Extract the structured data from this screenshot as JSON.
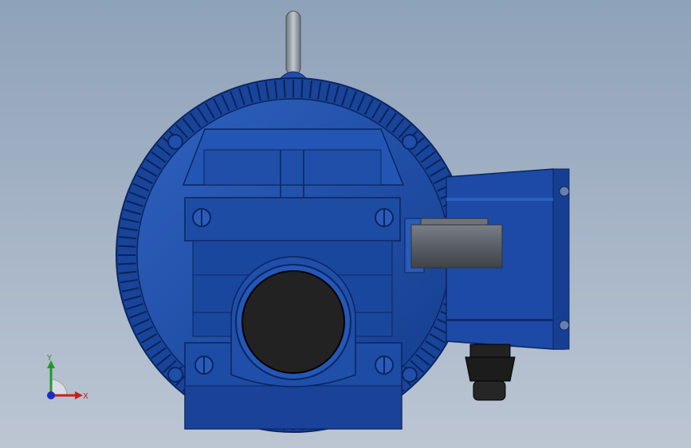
{
  "viewport": {
    "background_top": "#8ea2b9",
    "background_bottom": "#bcc6d3"
  },
  "model": {
    "body_color": "#1f4fa8",
    "body_dark": "#0f2c6e",
    "body_light": "#3a6cc8",
    "shaft_color": "#5a5f66",
    "bore_color": "#222222",
    "gland_color": "#1c1c1c",
    "lifting_eye_color": "#9aa0a8"
  },
  "triad": {
    "x_label": "X",
    "y_label": "Y",
    "x_color": "#c8201a",
    "y_color": "#1f9a2a",
    "z_color": "#1d2bc8"
  }
}
